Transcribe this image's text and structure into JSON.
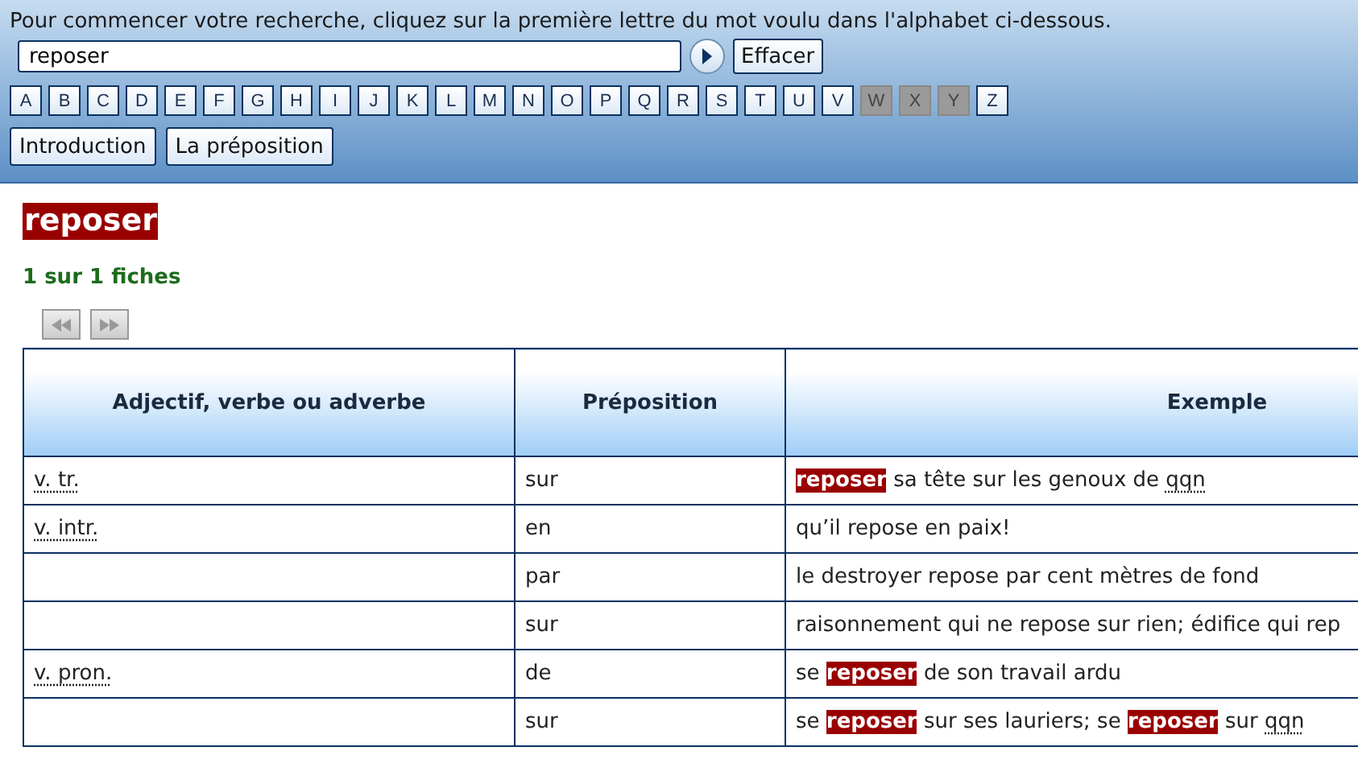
{
  "header": {
    "instruction": "Pour commencer votre recherche, cliquez sur la première lettre du mot voulu dans l'alphabet ci-dessous.",
    "search": {
      "value": "reposer"
    },
    "clear_button": "Effacer",
    "letters": [
      {
        "label": "A",
        "disabled": false
      },
      {
        "label": "B",
        "disabled": false
      },
      {
        "label": "C",
        "disabled": false
      },
      {
        "label": "D",
        "disabled": false
      },
      {
        "label": "E",
        "disabled": false
      },
      {
        "label": "F",
        "disabled": false
      },
      {
        "label": "G",
        "disabled": false
      },
      {
        "label": "H",
        "disabled": false
      },
      {
        "label": "I",
        "disabled": false
      },
      {
        "label": "J",
        "disabled": false
      },
      {
        "label": "K",
        "disabled": false
      },
      {
        "label": "L",
        "disabled": false
      },
      {
        "label": "M",
        "disabled": false
      },
      {
        "label": "N",
        "disabled": false
      },
      {
        "label": "O",
        "disabled": false
      },
      {
        "label": "P",
        "disabled": false
      },
      {
        "label": "Q",
        "disabled": false
      },
      {
        "label": "R",
        "disabled": false
      },
      {
        "label": "S",
        "disabled": false
      },
      {
        "label": "T",
        "disabled": false
      },
      {
        "label": "U",
        "disabled": false
      },
      {
        "label": "V",
        "disabled": false
      },
      {
        "label": "W",
        "disabled": true
      },
      {
        "label": "X",
        "disabled": true
      },
      {
        "label": "Y",
        "disabled": true
      },
      {
        "label": "Z",
        "disabled": false
      }
    ],
    "nav_buttons": [
      "Introduction",
      "La préposition"
    ]
  },
  "entry": {
    "word": "reposer",
    "count": "1 sur 1 fiches"
  },
  "table": {
    "columns": [
      "Adjectif, verbe ou adverbe",
      "Préposition",
      "Exemple"
    ],
    "rows": [
      {
        "category": "v. tr.",
        "preposition": "sur",
        "example": [
          {
            "kind": "highlight",
            "text": "reposer"
          },
          {
            "kind": "plain",
            "text": " sa tête sur les genoux de "
          },
          {
            "kind": "abbr",
            "text": "qqn"
          }
        ]
      },
      {
        "category": "v. intr.",
        "preposition": "en",
        "example": [
          {
            "kind": "plain",
            "text": "qu’il repose en paix!"
          }
        ]
      },
      {
        "preposition": "par",
        "example": [
          {
            "kind": "plain",
            "text": "le destroyer repose par cent mètres de fond"
          }
        ]
      },
      {
        "preposition": "sur",
        "example": [
          {
            "kind": "plain",
            "text": "raisonnement qui ne repose sur rien; édifice qui rep"
          }
        ]
      },
      {
        "category": "v. pron.",
        "preposition": "de",
        "example": [
          {
            "kind": "plain",
            "text": "se "
          },
          {
            "kind": "highlight",
            "text": "reposer"
          },
          {
            "kind": "plain",
            "text": " de son travail ardu"
          }
        ]
      },
      {
        "preposition": "sur",
        "example": [
          {
            "kind": "plain",
            "text": "se "
          },
          {
            "kind": "highlight",
            "text": "reposer"
          },
          {
            "kind": "plain",
            "text": " sur ses lauriers; se "
          },
          {
            "kind": "highlight",
            "text": "reposer"
          },
          {
            "kind": "plain",
            "text": " sur "
          },
          {
            "kind": "abbr",
            "text": "qqn"
          }
        ]
      }
    ]
  }
}
